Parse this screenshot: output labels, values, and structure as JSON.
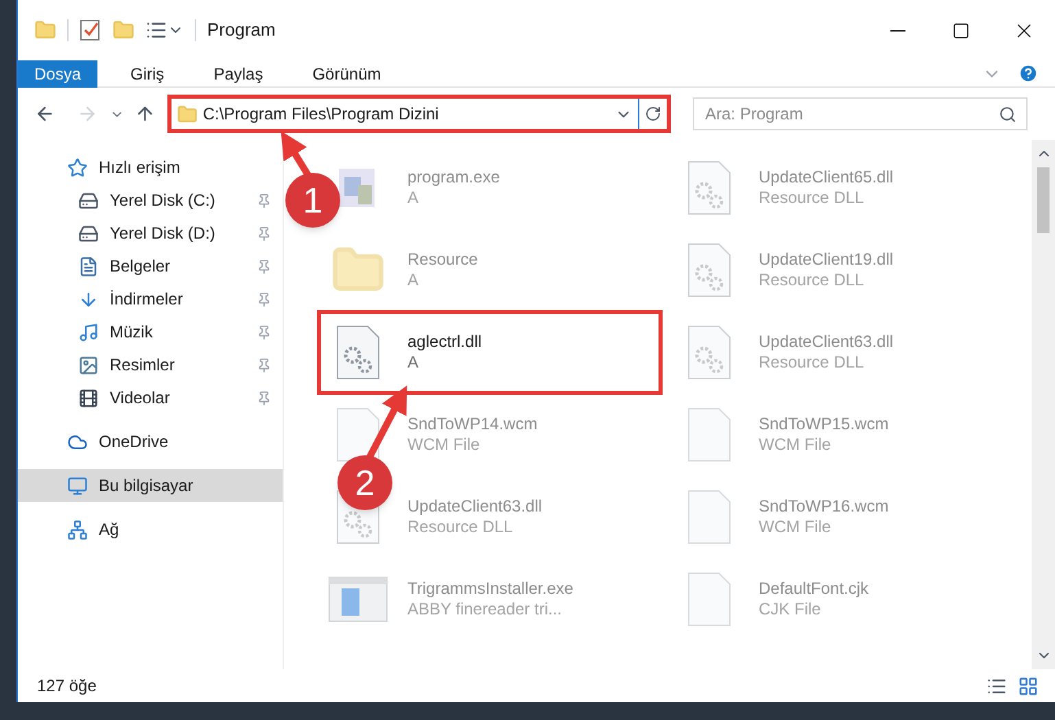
{
  "window": {
    "title": "Program"
  },
  "ribbon_tabs": [
    {
      "label": "Dosya",
      "selected": true
    },
    {
      "label": "Giriş",
      "selected": false
    },
    {
      "label": "Paylaş",
      "selected": false
    },
    {
      "label": "Görünüm",
      "selected": false
    }
  ],
  "address_bar": {
    "path": "C:\\Program Files\\Program Dizini",
    "highlighted": true
  },
  "search": {
    "placeholder": "Ara: Program"
  },
  "sidebar": {
    "items": [
      {
        "label": "Hızlı erişim",
        "kind": "star",
        "pinned": false,
        "selected": false,
        "children": [
          {
            "label": "Yerel Disk (C:)",
            "kind": "drive-c",
            "pinned": true,
            "selected": false
          },
          {
            "label": "Yerel Disk (D:)",
            "kind": "drive",
            "pinned": true,
            "selected": false
          },
          {
            "label": "Belgeler",
            "kind": "document",
            "pinned": true,
            "selected": false
          },
          {
            "label": "İndirmeler",
            "kind": "download",
            "pinned": true,
            "selected": false
          },
          {
            "label": "Müzik",
            "kind": "music",
            "pinned": true,
            "selected": false
          },
          {
            "label": "Resimler",
            "kind": "picture",
            "pinned": true,
            "selected": false
          },
          {
            "label": "Videolar",
            "kind": "video",
            "pinned": true,
            "selected": false
          }
        ]
      },
      {
        "label": "OneDrive",
        "kind": "cloud",
        "pinned": false,
        "selected": false
      },
      {
        "label": "Bu bilgisayar",
        "kind": "computer",
        "pinned": false,
        "selected": true
      },
      {
        "label": "Ağ",
        "kind": "network",
        "pinned": false,
        "selected": false
      }
    ]
  },
  "files": [
    {
      "name": "program.exe",
      "detail": "A",
      "kind": "exe",
      "dimmed": true,
      "highlighted": false
    },
    {
      "name": "UpdateClient65.dll",
      "detail": "Resource DLL",
      "kind": "dll",
      "dimmed": true,
      "highlighted": false
    },
    {
      "name": "Resource",
      "detail": "A",
      "kind": "folder",
      "dimmed": true,
      "highlighted": false
    },
    {
      "name": "UpdateClient19.dll",
      "detail": "Resource DLL",
      "kind": "dll",
      "dimmed": true,
      "highlighted": false
    },
    {
      "name": "aglectrl.dll",
      "detail": "A",
      "kind": "dll",
      "dimmed": false,
      "highlighted": true
    },
    {
      "name": "UpdateClient63.dll",
      "detail": "Resource DLL",
      "kind": "dll",
      "dimmed": true,
      "highlighted": false
    },
    {
      "name": "SndToWP14.wcm",
      "detail": "WCM File",
      "kind": "blank",
      "dimmed": true,
      "highlighted": false
    },
    {
      "name": "SndToWP15.wcm",
      "detail": "WCM File",
      "kind": "blank",
      "dimmed": true,
      "highlighted": false
    },
    {
      "name": "UpdateClient63.dll",
      "detail": "Resource DLL",
      "kind": "dll",
      "dimmed": true,
      "highlighted": false
    },
    {
      "name": "SndToWP16.wcm",
      "detail": "WCM File",
      "kind": "blank",
      "dimmed": true,
      "highlighted": false
    },
    {
      "name": "TrigrammsInstaller.exe",
      "detail": "ABBY finereader tri...",
      "kind": "installer",
      "dimmed": true,
      "highlighted": false
    },
    {
      "name": "DefaultFont.cjk",
      "detail": "CJK File",
      "kind": "blank",
      "dimmed": true,
      "highlighted": false
    }
  ],
  "status_bar": {
    "count": "127 öğe"
  },
  "callouts": [
    {
      "label": "1"
    },
    {
      "label": "2"
    }
  ]
}
